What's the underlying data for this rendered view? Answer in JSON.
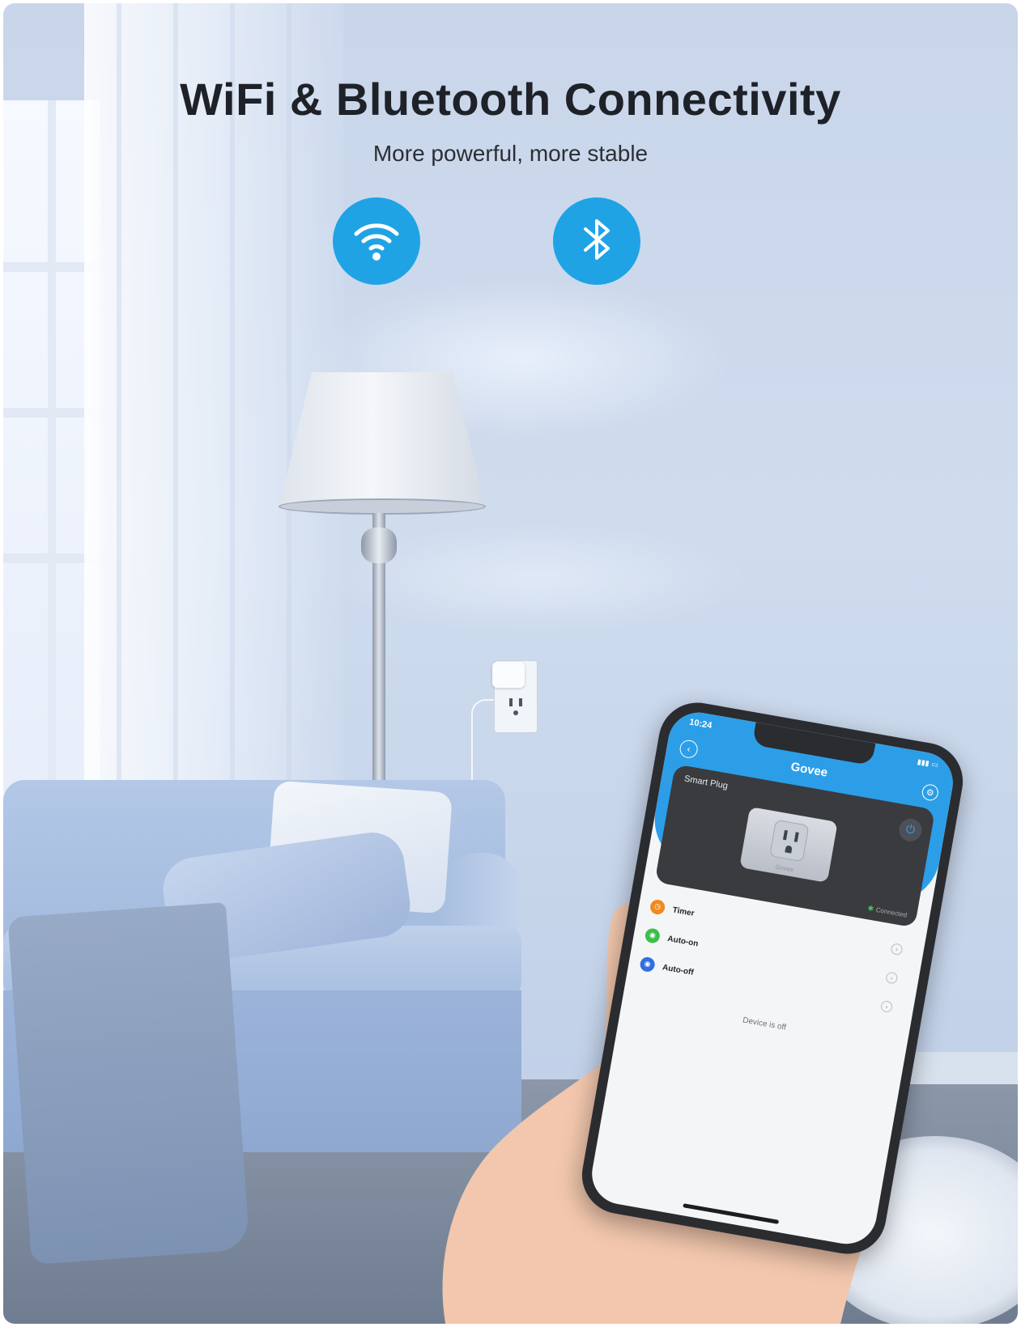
{
  "headline": {
    "title": "WiFi & Bluetooth Connectivity",
    "subtitle": "More powerful, more stable"
  },
  "badges": [
    {
      "icon": "wifi-icon",
      "color": "#1fa3e5"
    },
    {
      "icon": "bluetooth-icon",
      "color": "#1fa3e5"
    }
  ],
  "phone_app": {
    "status_time": "10:24",
    "brand": "Govee",
    "device_name": "Smart Plug",
    "plug_brand": "Govee",
    "connection_status": "Connected",
    "menu": [
      {
        "label": "Timer",
        "icon": "timer-icon",
        "color": "#f08a1c"
      },
      {
        "label": "Auto-on",
        "icon": "auto-on-icon",
        "color": "#3cbf4a"
      },
      {
        "label": "Auto-off",
        "icon": "auto-off-icon",
        "color": "#2f6fe0"
      }
    ],
    "device_state": "Device is off",
    "accent_color": "#2c9ee8"
  }
}
